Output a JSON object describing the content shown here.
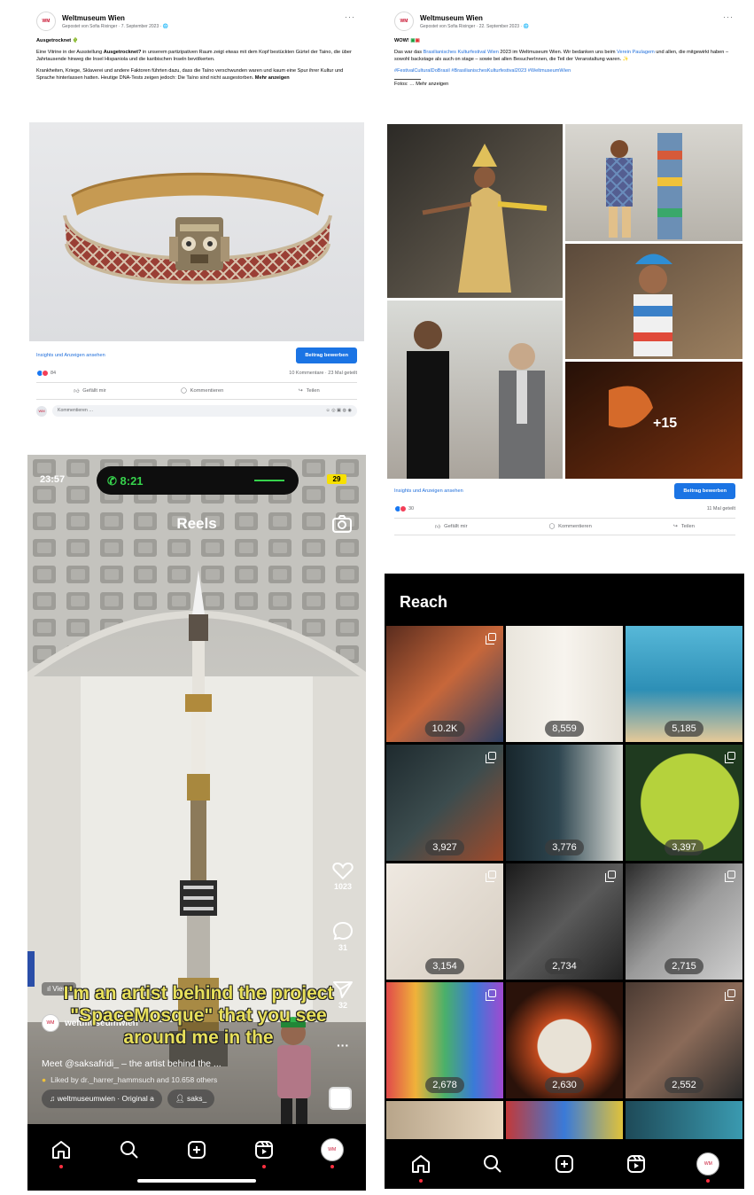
{
  "facebook_post_1": {
    "page_name": "Weltmuseum Wien",
    "byline": "Gepostet von Sofia Rixinger · 7. September 2023 · ",
    "more": "···",
    "headline": "Ausgetrocknet",
    "paragraph1_part1": "Eine Vitrine in der Ausstellung ",
    "paragraph1_bold": "Ausgetrocknet?",
    "paragraph1_part2": " in unserem partizipativen Raum zeigt etwas mit dem Kopf bestückten Gürtel der Taino, die über Jahrtausende hinweg die Insel Hispaniola und die karibischen Inseln bevölkerten.",
    "paragraph2": "Krankheiten, Kriege, Sklaverei und andere Faktoren führten dazu, dass die Taíno verschwunden waren und kaum eine Spur ihrer Kultur und Sprache hinterlassen hatten. Heutige DNA-Tests zeigen jedoch: Die Taíno sind nicht ausgestorben.",
    "more_link": "Mehr anzeigen",
    "insights_link": "Insights und Anzeigen ansehen",
    "boost_button": "Beitrag bewerben",
    "reactions_count": "84",
    "comments_shares": "10 Kommentare · 23 Mal geteilt",
    "like": "Gefällt mir",
    "comment": "Kommentieren",
    "share": "Teilen",
    "comment_placeholder": "Kommentieren …"
  },
  "facebook_post_2": {
    "page_name": "Weltmuseum Wien",
    "byline": "Gepostet von Sofia Rixinger · 22. September 2023 · ",
    "more": "···",
    "headline": "WOW!",
    "text_part1": "Das war das ",
    "text_link1": "Brasilianisches Kulturfestival Wien",
    "text_part2": " 2023 im Weltmuseum Wien. Wir bedanken uns beim ",
    "text_link2": "Verein Paulagem",
    "text_part3": " und allen, die mitgewirkt haben – sowohl backstage als auch on stage – sowie bei allen BesucherInnen, die Teil der Veranstaltung waren.",
    "hashtags": "#FestivalCulturalDoBrasil #BrasilianischesKulturfestival2023 #WeltmuseumWien",
    "photos_more": "Fotos: … Mehr anzeigen",
    "photo_overlay": "+15",
    "insights_link": "Insights und Anzeigen ansehen",
    "boost_button": "Beitrag bewerben",
    "reactions_count": "30",
    "shares": "11 Mal geteilt",
    "like": "Gefällt mir",
    "comment": "Kommentieren",
    "share": "Teilen"
  },
  "reel": {
    "time": "23:57",
    "call_timer": "8:21",
    "battery": "29",
    "title": "Reels",
    "likes": "1023",
    "comments": "31",
    "shares": "32",
    "more": "···",
    "views_chip": "Views",
    "username": "weltmuseumwien",
    "subtitle": "I'm an artist behind the project \"SpaceMosque\" that you see around me in the",
    "caption": "Meet @saksafridi_ – the artist behind the ...",
    "liked_by": "Liked by dr._harrer_hammsuch and 10.658 others",
    "audio_chip": "weltmuseumwien · Original a",
    "tag_chip": "saks_"
  },
  "reach": {
    "title": "Reach",
    "tiles": [
      {
        "count": "10.2K",
        "multi": true
      },
      {
        "count": "8,559",
        "multi": false
      },
      {
        "count": "5,185",
        "multi": false
      },
      {
        "count": "3,927",
        "multi": true
      },
      {
        "count": "3,776",
        "multi": false
      },
      {
        "count": "3,397",
        "multi": true
      },
      {
        "count": "3,154",
        "multi": true
      },
      {
        "count": "2,734",
        "multi": true
      },
      {
        "count": "2,715",
        "multi": true
      },
      {
        "count": "2,678",
        "multi": true
      },
      {
        "count": "2,630",
        "multi": false
      },
      {
        "count": "2,552",
        "multi": true
      }
    ]
  },
  "nav_icons": [
    "home-icon",
    "search-icon",
    "create-icon",
    "reels-icon",
    "profile-avatar"
  ],
  "colors": {
    "facebook_blue": "#1b74e4",
    "facebook_link": "#216fdb",
    "notification_red": "#ff3040",
    "call_green": "#36d24c",
    "subtitle_yellow": "#e8e05b"
  }
}
